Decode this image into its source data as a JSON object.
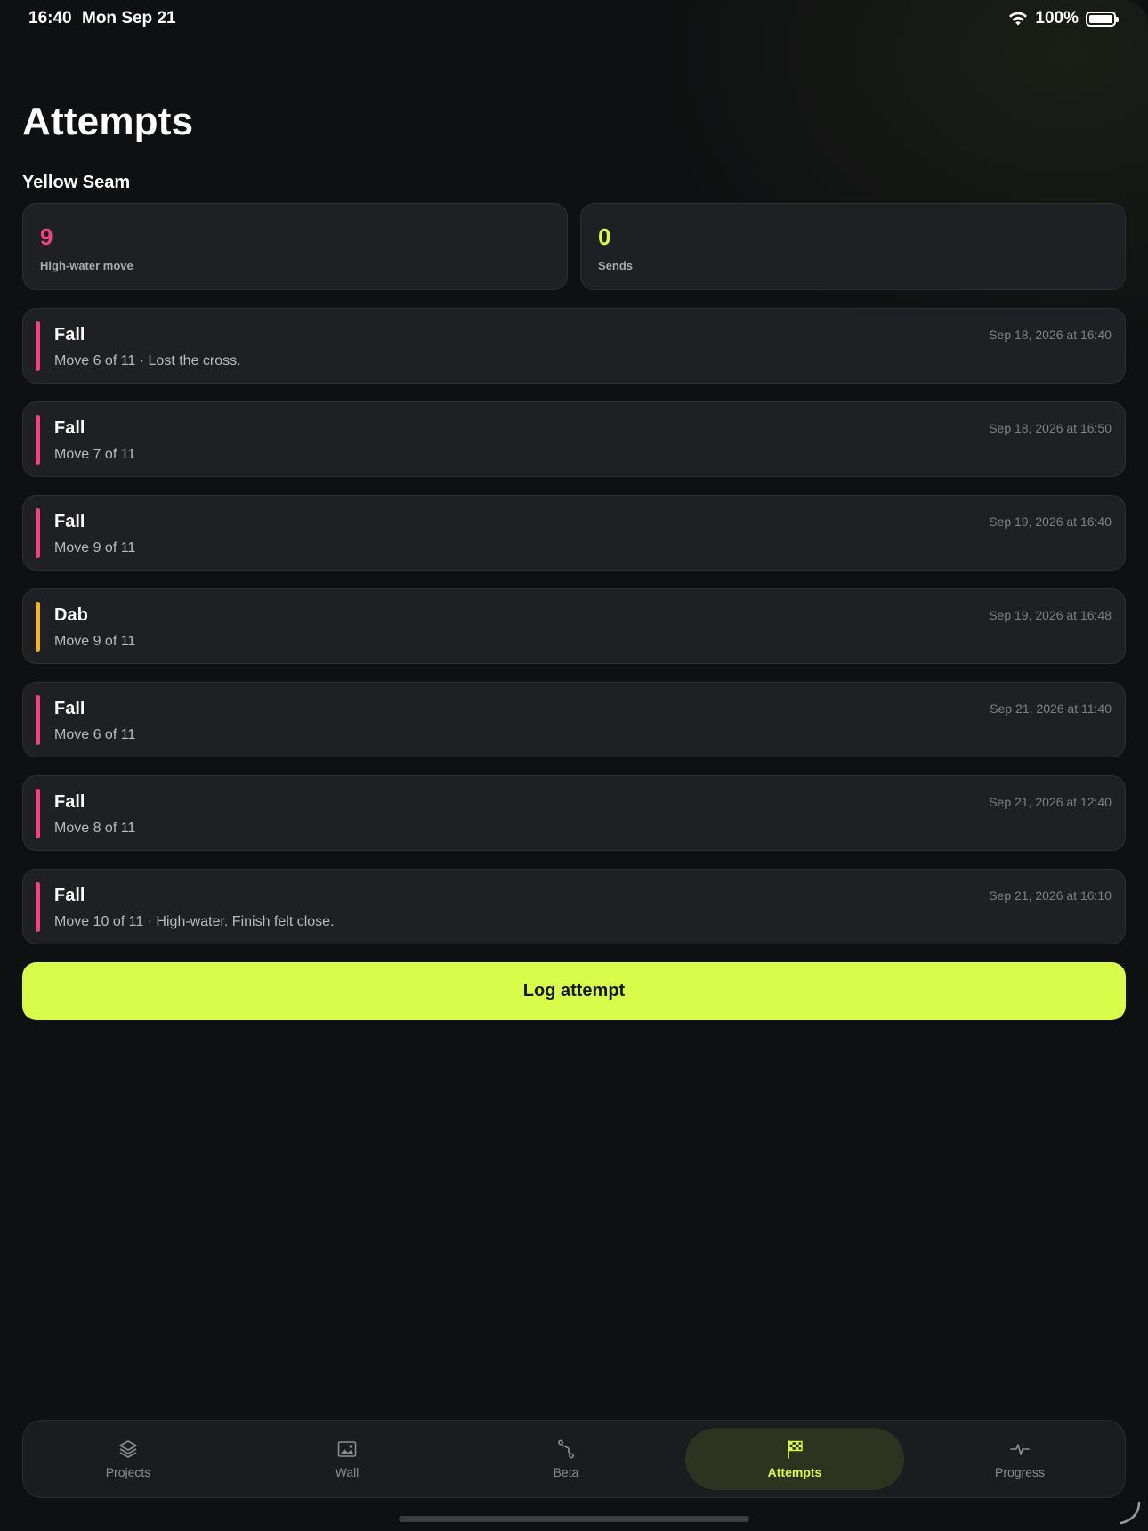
{
  "status_bar": {
    "time": "16:40",
    "date": "Mon Sep 21",
    "battery": "100%"
  },
  "page": {
    "title": "Attempts",
    "project_name": "Yellow Seam"
  },
  "stats": [
    {
      "value": "9",
      "label": "High-water move",
      "color": "#f0457f"
    },
    {
      "value": "0",
      "label": "Sends",
      "color": "#d9fb4a"
    }
  ],
  "attempts": [
    {
      "outcome": "Fall",
      "detail": "Move 6 of 11 · Lost the cross.",
      "date": "Sep 18, 2026 at 16:40",
      "color": "#f0457f"
    },
    {
      "outcome": "Fall",
      "detail": "Move 7 of 11",
      "date": "Sep 18, 2026 at 16:50",
      "color": "#f0457f"
    },
    {
      "outcome": "Fall",
      "detail": "Move 9 of 11",
      "date": "Sep 19, 2026 at 16:40",
      "color": "#f0457f"
    },
    {
      "outcome": "Dab",
      "detail": "Move 9 of 11",
      "date": "Sep 19, 2026 at 16:48",
      "color": "#f5b12e"
    },
    {
      "outcome": "Fall",
      "detail": "Move 6 of 11",
      "date": "Sep 21, 2026 at 11:40",
      "color": "#f0457f"
    },
    {
      "outcome": "Fall",
      "detail": "Move 8 of 11",
      "date": "Sep 21, 2026 at 12:40",
      "color": "#f0457f"
    },
    {
      "outcome": "Fall",
      "detail": "Move 10 of 11 · High-water. Finish felt close.",
      "date": "Sep 21, 2026 at 16:10",
      "color": "#f0457f"
    }
  ],
  "actions": {
    "log_attempt": "Log attempt"
  },
  "tabs": [
    {
      "label": "Projects",
      "icon": "layers-icon",
      "active": false
    },
    {
      "label": "Wall",
      "icon": "image-icon",
      "active": false
    },
    {
      "label": "Beta",
      "icon": "route-icon",
      "active": false
    },
    {
      "label": "Attempts",
      "icon": "checkered-flag-icon",
      "active": true
    },
    {
      "label": "Progress",
      "icon": "pulse-icon",
      "active": false
    }
  ],
  "colors": {
    "accent": "#d9fb4a",
    "fall": "#f0457f",
    "dab": "#f5b12e",
    "card": "#1e2024",
    "background": "#0f1012"
  }
}
